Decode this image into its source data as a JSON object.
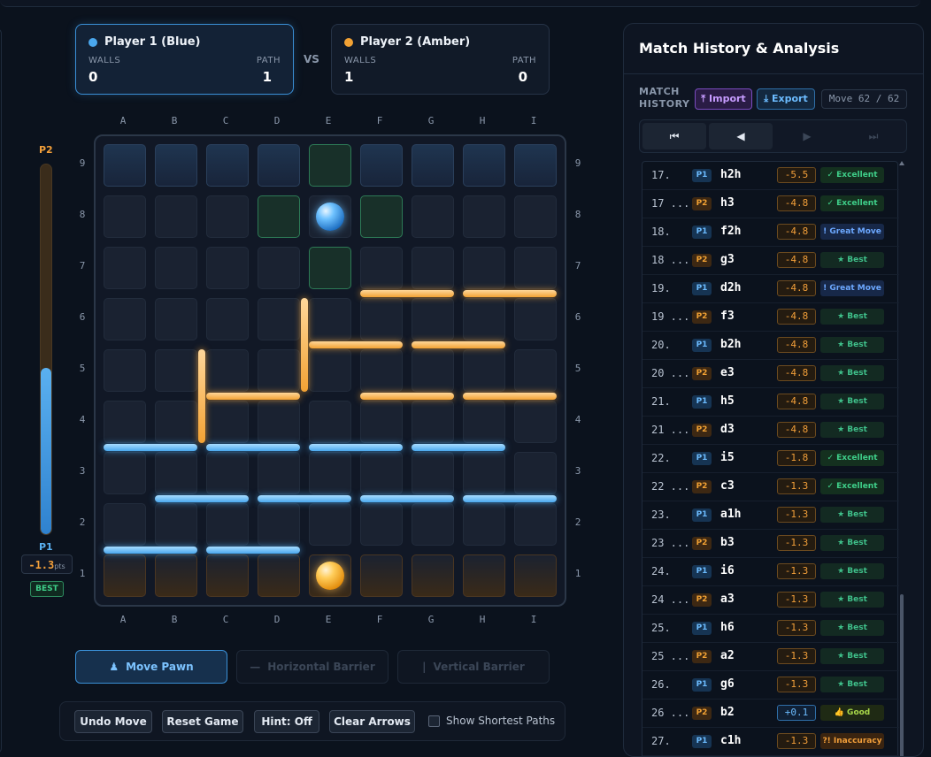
{
  "players": {
    "p1": {
      "name": "Player 1 (Blue)",
      "walls_label": "WALLS",
      "walls": "0",
      "path_label": "PATH",
      "path": "1",
      "color": "#4aa8ee"
    },
    "p2": {
      "name": "Player 2 (Amber)",
      "walls_label": "WALLS",
      "walls": "1",
      "path_label": "PATH",
      "path": "0",
      "color": "#f2a234"
    },
    "vs": "VS"
  },
  "board": {
    "cols": [
      "A",
      "B",
      "C",
      "D",
      "E",
      "F",
      "G",
      "H",
      "I"
    ],
    "rows": [
      "9",
      "8",
      "7",
      "6",
      "5",
      "4",
      "3",
      "2",
      "1"
    ],
    "highlighted_cells": [
      "E9",
      "D8",
      "F8",
      "E7"
    ],
    "pawns": {
      "p1": "E8",
      "p2": "E1"
    },
    "walls_blue_h": [
      [
        "A",
        4
      ],
      [
        "C",
        4
      ],
      [
        "E",
        4
      ],
      [
        "G",
        4
      ],
      [
        "B",
        3
      ],
      [
        "D",
        3
      ],
      [
        "F",
        3
      ],
      [
        "H",
        3
      ],
      [
        "A",
        2
      ],
      [
        "C",
        2
      ]
    ],
    "walls_amber_h": [
      [
        "F",
        7
      ],
      [
        "H",
        7
      ],
      [
        "E",
        6
      ],
      [
        "G",
        6
      ],
      [
        "C",
        5
      ],
      [
        "F",
        5
      ],
      [
        "H",
        5
      ]
    ],
    "walls_amber_v": [
      [
        "B",
        5
      ],
      [
        "D",
        6
      ]
    ]
  },
  "eval": {
    "top_label": "P2",
    "bottom_label": "P1",
    "score": "-1.3",
    "unit": "pts",
    "badge": "BEST",
    "p1_share": 0.45
  },
  "modes": [
    {
      "label": "Move Pawn",
      "icon": "person-icon",
      "active": true
    },
    {
      "label": "Horizontal Barrier",
      "icon": "horizontal-line-icon",
      "active": false
    },
    {
      "label": "Vertical Barrier",
      "icon": "vertical-line-icon",
      "active": false
    }
  ],
  "toolbar": {
    "undo": "Undo Move",
    "reset": "Reset Game",
    "hint": "Hint: Off",
    "clear": "Clear Arrows",
    "show_paths": "Show Shortest Paths"
  },
  "history": {
    "title": "Match History & Analysis",
    "label_line1": "MATCH",
    "label_line2": "HISTORY",
    "import": "Import",
    "export": "Export",
    "move_counter": "Move 62 / 62",
    "nav": [
      "⏮",
      "◀",
      "▶",
      "⏭"
    ],
    "rows": [
      {
        "num": "17.",
        "player": "P1",
        "move": "h2h",
        "eval": "-5.5",
        "badge": "✓ Excellent",
        "kind": "excellent"
      },
      {
        "num": "17 ...",
        "player": "P2",
        "move": "h3",
        "eval": "-4.8",
        "badge": "✓ Excellent",
        "kind": "excellent"
      },
      {
        "num": "18.",
        "player": "P1",
        "move": "f2h",
        "eval": "-4.8",
        "badge": "! Great Move",
        "kind": "great"
      },
      {
        "num": "18 ...",
        "player": "P2",
        "move": "g3",
        "eval": "-4.8",
        "badge": "★ Best",
        "kind": "best"
      },
      {
        "num": "19.",
        "player": "P1",
        "move": "d2h",
        "eval": "-4.8",
        "badge": "! Great Move",
        "kind": "great"
      },
      {
        "num": "19 ...",
        "player": "P2",
        "move": "f3",
        "eval": "-4.8",
        "badge": "★ Best",
        "kind": "best"
      },
      {
        "num": "20.",
        "player": "P1",
        "move": "b2h",
        "eval": "-4.8",
        "badge": "★ Best",
        "kind": "best"
      },
      {
        "num": "20 ...",
        "player": "P2",
        "move": "e3",
        "eval": "-4.8",
        "badge": "★ Best",
        "kind": "best"
      },
      {
        "num": "21.",
        "player": "P1",
        "move": "h5",
        "eval": "-4.8",
        "badge": "★ Best",
        "kind": "best"
      },
      {
        "num": "21 ...",
        "player": "P2",
        "move": "d3",
        "eval": "-4.8",
        "badge": "★ Best",
        "kind": "best"
      },
      {
        "num": "22.",
        "player": "P1",
        "move": "i5",
        "eval": "-1.8",
        "badge": "✓ Excellent",
        "kind": "excellent"
      },
      {
        "num": "22 ...",
        "player": "P2",
        "move": "c3",
        "eval": "-1.3",
        "badge": "✓ Excellent",
        "kind": "excellent"
      },
      {
        "num": "23.",
        "player": "P1",
        "move": "a1h",
        "eval": "-1.3",
        "badge": "★ Best",
        "kind": "best"
      },
      {
        "num": "23 ...",
        "player": "P2",
        "move": "b3",
        "eval": "-1.3",
        "badge": "★ Best",
        "kind": "best"
      },
      {
        "num": "24.",
        "player": "P1",
        "move": "i6",
        "eval": "-1.3",
        "badge": "★ Best",
        "kind": "best"
      },
      {
        "num": "24 ...",
        "player": "P2",
        "move": "a3",
        "eval": "-1.3",
        "badge": "★ Best",
        "kind": "best"
      },
      {
        "num": "25.",
        "player": "P1",
        "move": "h6",
        "eval": "-1.3",
        "badge": "★ Best",
        "kind": "best"
      },
      {
        "num": "25 ...",
        "player": "P2",
        "move": "a2",
        "eval": "-1.3",
        "badge": "★ Best",
        "kind": "best"
      },
      {
        "num": "26.",
        "player": "P1",
        "move": "g6",
        "eval": "-1.3",
        "badge": "★ Best",
        "kind": "best"
      },
      {
        "num": "26 ...",
        "player": "P2",
        "move": "b2",
        "eval": "+0.1",
        "badge": "👍 Good",
        "kind": "good"
      },
      {
        "num": "27.",
        "player": "P1",
        "move": "c1h",
        "eval": "-1.3",
        "badge": "?! Inaccuracy",
        "kind": "inacc"
      }
    ]
  }
}
